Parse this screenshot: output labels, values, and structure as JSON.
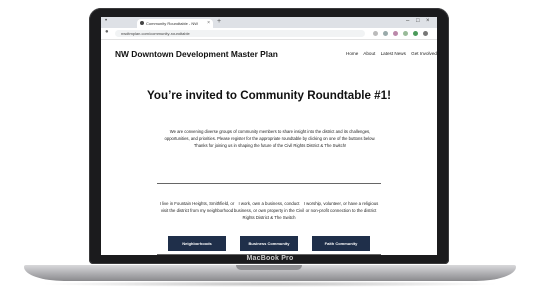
{
  "browser": {
    "tab_title": "Community Roundtable - NW",
    "tab_close": "×",
    "new_tab": "+",
    "url": "nwdtmplan.com/community-roundtable",
    "window_minimize": "–",
    "window_maximize": "□",
    "window_close": "×"
  },
  "site": {
    "title": "NW Downtown Development Master Plan",
    "nav": [
      "Home",
      "About",
      "Latest News",
      "Get Involved"
    ]
  },
  "hero": {
    "heading": "You’re invited to Community Roundtable #1!",
    "intro": "We are convening diverse groups of community members to share insight into the district and its challenges, opportunities, and priorities. Please register for the appropriate roundtable by clicking on one of the buttons below. Thanks for joining us in shaping the future of the Civil Rights District & The Switch!"
  },
  "options": [
    {
      "text": "I live in Fountain Heights, Smithfield, or visit the district from my neighborhood",
      "button": "Neighborhoods"
    },
    {
      "text": "I work, own a business, conduct business, or own property in the Civil Rights District & The Switch",
      "button": "Business Community"
    },
    {
      "text": "I worship, volunteer, or have a religious or non-profit connection to the district",
      "button": "Faith Community"
    }
  ],
  "device": {
    "brand": "MacBook Pro"
  },
  "colors": {
    "button_bg": "#1f2f4a",
    "laptop_bezel": "#1b1b1d"
  }
}
